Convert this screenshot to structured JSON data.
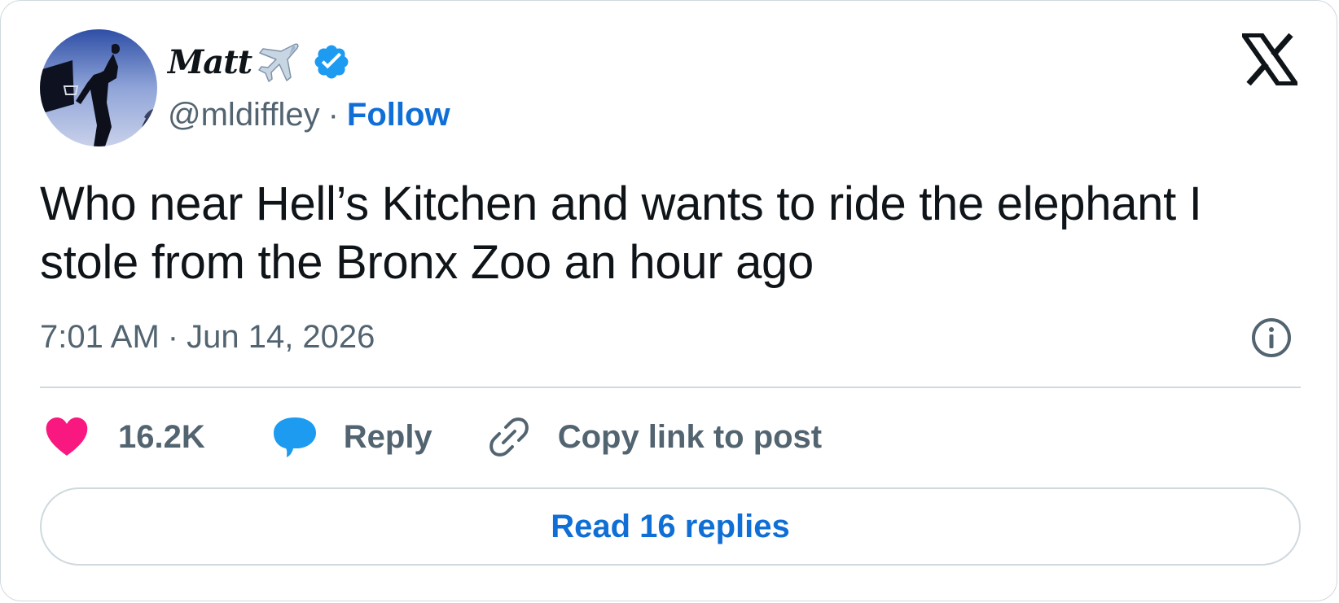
{
  "author": {
    "display_name": "Matt",
    "display_name_emoji": "airplane-icon",
    "verified": true,
    "handle": "@mldiffley",
    "separator": "·",
    "follow_label": "Follow"
  },
  "tweet": {
    "text": "Who near Hell’s Kitchen and wants to ride the elephant I stole from the Bronx Zoo an hour ago",
    "time": "7:01 AM",
    "separator": "·",
    "date": "Jun 14, 2026"
  },
  "actions": {
    "like_count": "16.2K",
    "reply_label": "Reply",
    "copy_link_label": "Copy link to post"
  },
  "read_replies_label": "Read 16 replies",
  "colors": {
    "accent_blue": "#0f6fd6",
    "verified_blue": "#1d9bf0",
    "like_pink": "#f91880",
    "secondary_text": "#536471",
    "border": "#cfd9de"
  },
  "icons": [
    "avatar",
    "airplane-icon",
    "verified-badge-icon",
    "x-logo-icon",
    "info-icon",
    "heart-icon",
    "reply-bubble-icon",
    "link-icon"
  ]
}
